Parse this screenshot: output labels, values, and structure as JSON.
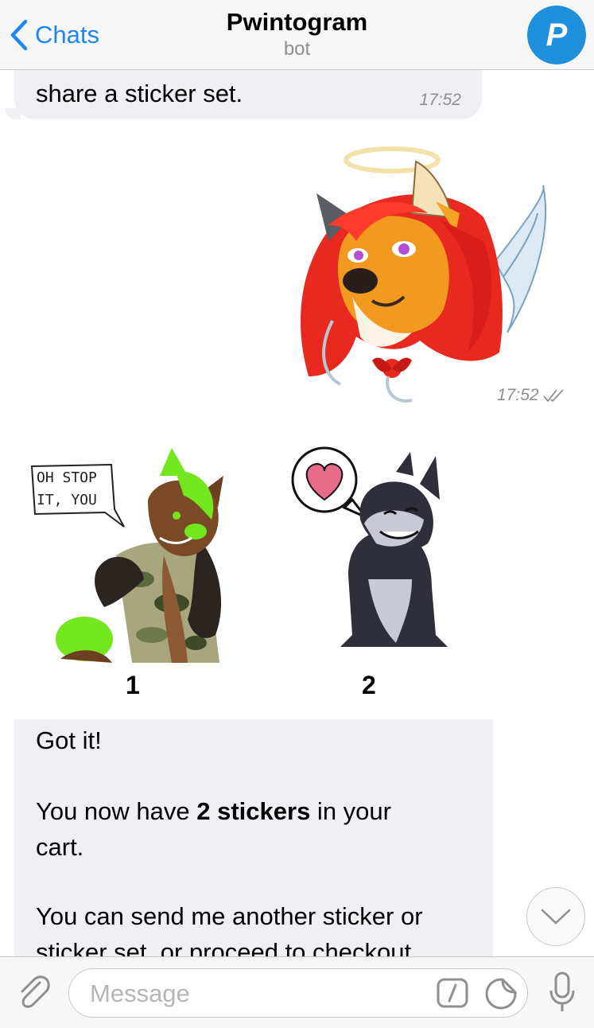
{
  "header": {
    "back_label": "Chats",
    "title": "Pwintogram",
    "subtitle": "bot",
    "avatar_letter": "P"
  },
  "messages": {
    "first": {
      "text": "share a sticker set.",
      "time": "17:52"
    },
    "sent_sticker": {
      "time": "17:52"
    },
    "sticker_grid": {
      "items": [
        {
          "number": "1",
          "speech": [
            "OH STOP",
            "IT, YOU"
          ]
        },
        {
          "number": "2"
        }
      ]
    },
    "bot_reply": {
      "line1": "Got it!",
      "line2_pre": "You now have ",
      "line2_bold": "2 stickers",
      "line2_post": " in your",
      "line3": "cart.",
      "line4": "You can send me another sticker or",
      "line5": "sticker set, or proceed to checkout"
    }
  },
  "input": {
    "placeholder": "Message"
  },
  "colors": {
    "accent": "#1e86f0",
    "avatar": "#1e90dd",
    "bubble": "#f0f0f4"
  }
}
